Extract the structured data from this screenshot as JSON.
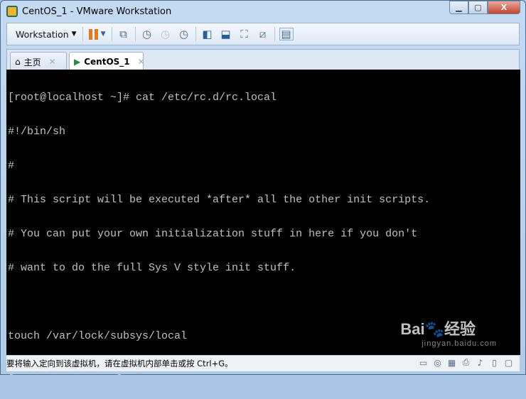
{
  "window": {
    "title": "CentOS_1 - VMware Workstation",
    "controls": {
      "minimize": "▁",
      "maximize": "▢",
      "close": "X"
    }
  },
  "toolbar": {
    "workstation_label": "Workstation",
    "icons": [
      "pause-icon",
      "send-ctrl-alt-del-icon",
      "snapshot-take-icon",
      "snapshot-revert-icon",
      "snapshot-manager-icon",
      "show-library-icon",
      "show-thumbnail-bar-icon",
      "full-screen-icon",
      "unity-icon",
      "console-view-icon"
    ]
  },
  "tabs": [
    {
      "label": "主页",
      "icon": "home-icon"
    },
    {
      "label": "CentOS_1",
      "icon": "vm-icon",
      "active": true
    }
  ],
  "terminal": {
    "lines": [
      "[root@localhost ~]# cat /etc/rc.d/rc.local",
      "#!/bin/sh",
      "#",
      "# This script will be executed *after* all the other init scripts.",
      "# You can put your own initialization stuff in here if you don't",
      "# want to do the full Sys V style init stuff.",
      "",
      "touch /var/lock/subsys/local"
    ],
    "prompt": "[root@localhost ~]# "
  },
  "status": {
    "message": "要将输入定向到该虚拟机，请在虚拟机内部单击或按 Ctrl+G。",
    "icons": [
      "hard-disk-icon",
      "cd-dvd-icon",
      "network-icon",
      "printer-icon",
      "sound-icon",
      "usb-icon",
      "message-icon"
    ]
  },
  "watermark": {
    "text": "Bai度经验",
    "sub": "jingyan.baidu.com"
  }
}
